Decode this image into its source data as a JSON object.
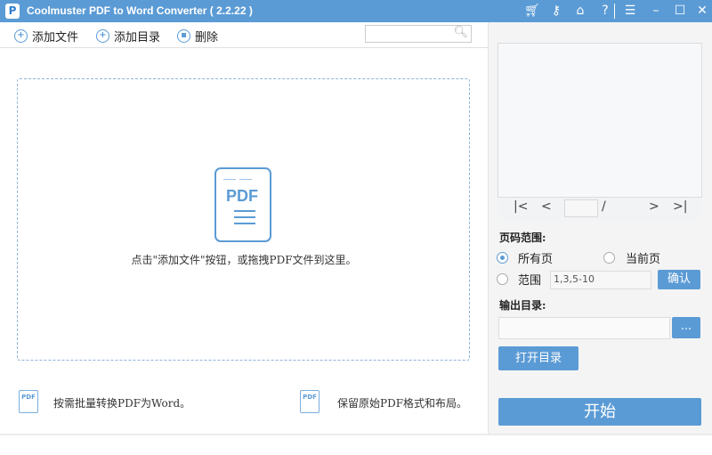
{
  "window": {
    "title": "Coolmuster PDF to Word Converter   ( 2.2.22 )",
    "logo": "P"
  },
  "titlebar_icons": [
    "cart-icon",
    "key-icon",
    "home-icon",
    "help-icon",
    "register-icon",
    "minimize-icon",
    "maximize-icon",
    "close-icon"
  ],
  "toolbar": {
    "add_file": "添加文件",
    "add_folder": "添加目录",
    "delete": "删除",
    "search_placeholder": ""
  },
  "drop": {
    "pdf_label": "PDF",
    "hint": "点击\"添加文件\"按钮，或拖拽PDF文件到这里。"
  },
  "features": [
    {
      "text": "按需批量转换PDF为Word。",
      "icon_label": "PDF"
    },
    {
      "text": "保留原始PDF格式和布局。",
      "icon_label": "PDF"
    }
  ],
  "preview": {
    "first": "|<",
    "prev": "<",
    "page": "",
    "sep": "/",
    "next": ">",
    "last": ">|"
  },
  "page_range": {
    "label": "页码范围:",
    "all": "所有页",
    "current": "当前页",
    "range": "范围",
    "range_value": "1,3,5-10",
    "confirm": "确认",
    "selected": "all"
  },
  "output": {
    "label": "输出目录:",
    "value": "",
    "browse": "...",
    "open": "打开目录"
  },
  "start": "开始",
  "colors": {
    "accent": "#5b9bd5"
  }
}
